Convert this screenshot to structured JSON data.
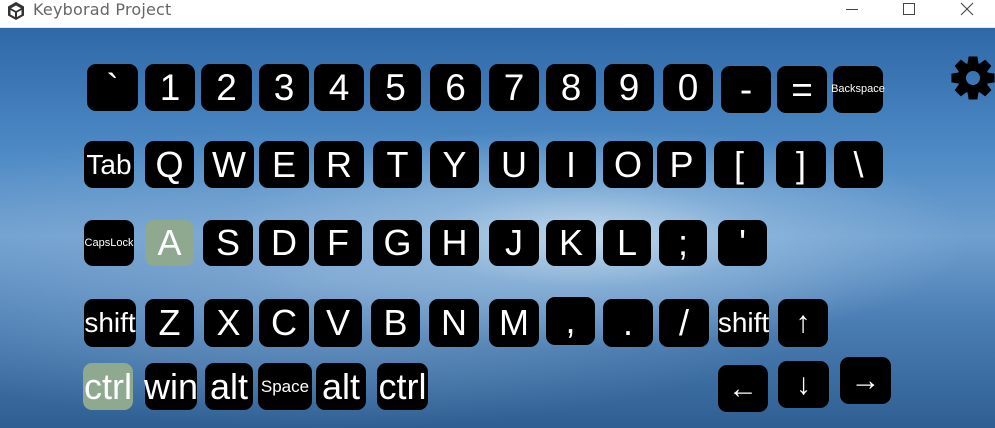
{
  "window": {
    "title": "Keyborad Project",
    "icons": {
      "app": "unity-icon",
      "minimize": "minimize-icon",
      "maximize": "maximize-icon",
      "close": "close-icon"
    }
  },
  "settings": {
    "icon": "gear-icon"
  },
  "colors": {
    "key_bg": "#000000",
    "key_text": "#ffffff",
    "key_pressed": "#8fa890"
  },
  "keyboard": {
    "row1": [
      "`",
      "1",
      "2",
      "3",
      "4",
      "5",
      "6",
      "7",
      "8",
      "9",
      "0",
      "-",
      "=",
      "Backspace"
    ],
    "row2": [
      "Tab",
      "Q",
      "W",
      "E",
      "R",
      "T",
      "Y",
      "U",
      "I",
      "O",
      "P",
      "[",
      "]",
      "\\"
    ],
    "row3": [
      "CapsLock",
      "A",
      "S",
      "D",
      "F",
      "G",
      "H",
      "J",
      "K",
      "L",
      ";",
      "'"
    ],
    "row4": [
      "shift",
      "Z",
      "X",
      "C",
      "V",
      "B",
      "N",
      "M",
      ",",
      ".",
      "/",
      "shift",
      "↑"
    ],
    "row5": [
      "ctrl",
      "win",
      "alt",
      "Space",
      "alt",
      "ctrl",
      "←",
      "↓",
      "→"
    ],
    "pressed_keys": [
      "A",
      "ctrl"
    ]
  }
}
